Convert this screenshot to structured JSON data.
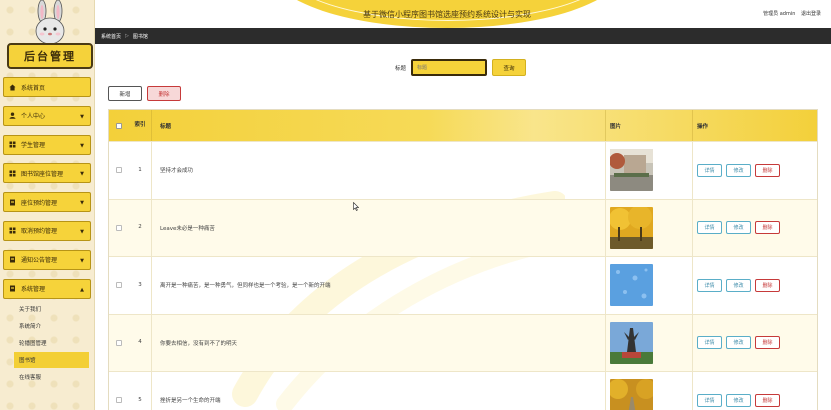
{
  "sidebar": {
    "title": "后台管理",
    "items": [
      {
        "label": "系统首页",
        "icon": "home-icon",
        "chevron": false
      },
      {
        "label": "个人中心",
        "icon": "user-icon",
        "chevron": true
      },
      {
        "label": "学生管理",
        "icon": "grid-icon",
        "chevron": true
      },
      {
        "label": "图书馆座位管理",
        "icon": "grid-icon",
        "chevron": true
      },
      {
        "label": "座位预约管理",
        "icon": "doc-icon",
        "chevron": true
      },
      {
        "label": "取消预约管理",
        "icon": "grid-icon",
        "chevron": true
      },
      {
        "label": "通知公告管理",
        "icon": "doc-icon",
        "chevron": true
      },
      {
        "label": "系统管理",
        "icon": "doc-icon",
        "chevron": true
      }
    ],
    "submenu": [
      {
        "label": "关于我们",
        "active": false
      },
      {
        "label": "系统简介",
        "active": false
      },
      {
        "label": "轮播图管理",
        "active": false
      },
      {
        "label": "图书馆",
        "active": true
      },
      {
        "label": "在线客服",
        "active": false
      }
    ]
  },
  "header": {
    "title": "基于微信小程序图书馆选座预约系统设计与实现",
    "user_label": "管理员 admin",
    "logout_label": "退出登录"
  },
  "breadcrumb": {
    "home": "系统首页",
    "separator": "▷",
    "current": "图书馆"
  },
  "search": {
    "label": "标题",
    "placeholder": "标题",
    "button": "查询"
  },
  "toolbar": {
    "add_label": "新增",
    "delete_label": "删除"
  },
  "table": {
    "columns": {
      "index": "索引",
      "title": "标题",
      "image": "图片",
      "actions": "操作"
    },
    "rows": [
      {
        "index": "1",
        "title": "坚持才会成功",
        "thumb": "campus"
      },
      {
        "index": "2",
        "title": "Leave未必是一种痛苦",
        "thumb": "yellow-trees"
      },
      {
        "index": "3",
        "title": "离开是一种痛苦，是一种勇气，但同样也是一个考验，是一个新的开端",
        "thumb": "water"
      },
      {
        "index": "4",
        "title": "你要去相信，没有到不了的明天",
        "thumb": "sculpture"
      },
      {
        "index": "5",
        "title": "挫折是另一个生命的开端",
        "thumb": "autumn-road"
      }
    ],
    "actions": {
      "detail": "详情",
      "edit": "修改",
      "delete": "删除"
    }
  },
  "colors": {
    "accent": "#f5d23a",
    "dark": "#3a2b0a",
    "danger": "#c63a3a",
    "info": "#3a8aa8"
  }
}
